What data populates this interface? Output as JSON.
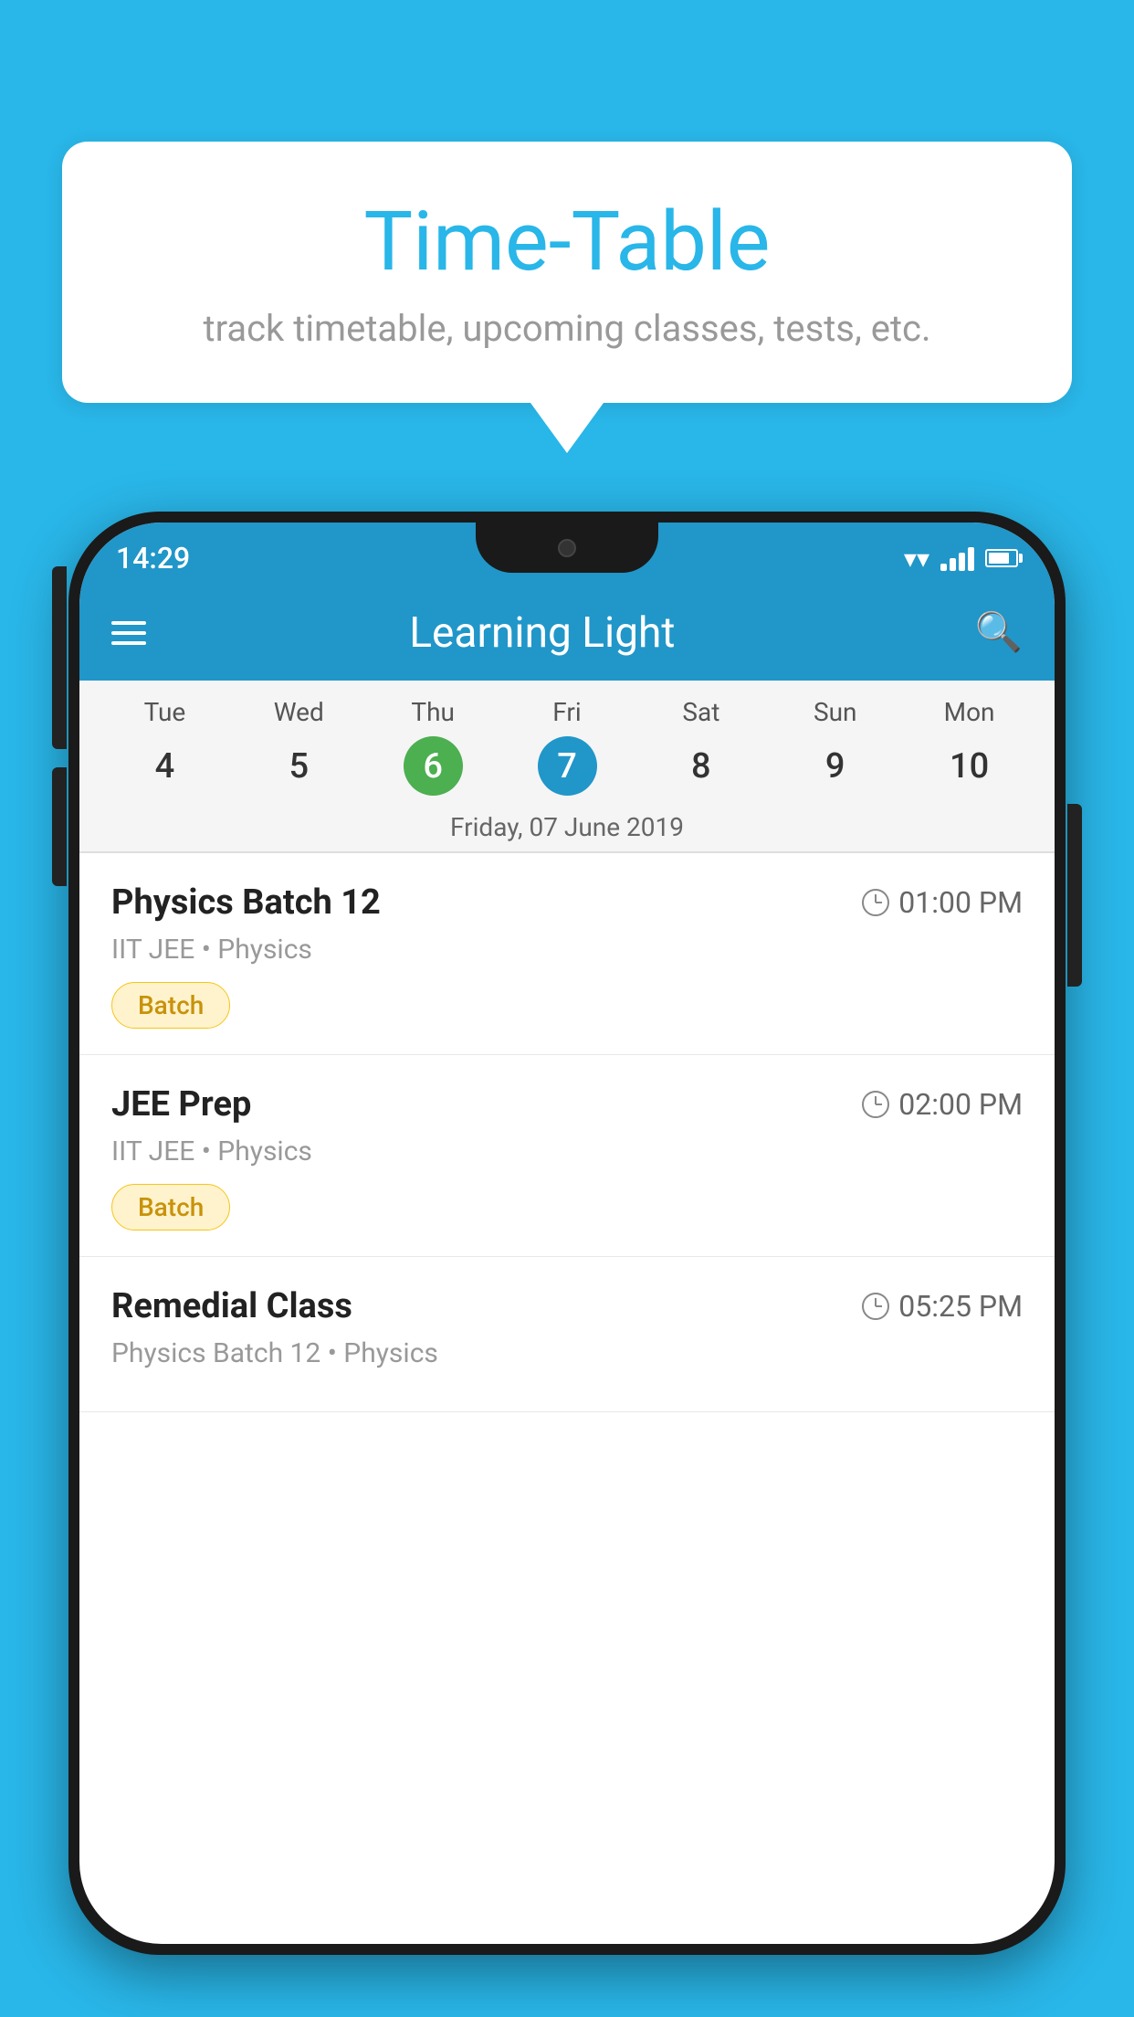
{
  "background_color": "#29b6e8",
  "speech_bubble": {
    "title": "Time-Table",
    "subtitle": "track timetable, upcoming classes, tests, etc."
  },
  "phone": {
    "status_bar": {
      "time": "14:29"
    },
    "app_bar": {
      "title": "Learning Light"
    },
    "calendar": {
      "days": [
        {
          "name": "Tue",
          "num": "4",
          "state": "normal"
        },
        {
          "name": "Wed",
          "num": "5",
          "state": "normal"
        },
        {
          "name": "Thu",
          "num": "6",
          "state": "today"
        },
        {
          "name": "Fri",
          "num": "7",
          "state": "selected"
        },
        {
          "name": "Sat",
          "num": "8",
          "state": "normal"
        },
        {
          "name": "Sun",
          "num": "9",
          "state": "normal"
        },
        {
          "name": "Mon",
          "num": "10",
          "state": "normal"
        }
      ],
      "selected_date_label": "Friday, 07 June 2019"
    },
    "schedule": [
      {
        "title": "Physics Batch 12",
        "time": "01:00 PM",
        "subtitle": "IIT JEE • Physics",
        "badge": "Batch"
      },
      {
        "title": "JEE Prep",
        "time": "02:00 PM",
        "subtitle": "IIT JEE • Physics",
        "badge": "Batch"
      },
      {
        "title": "Remedial Class",
        "time": "05:25 PM",
        "subtitle": "Physics Batch 12 • Physics",
        "badge": null
      }
    ]
  }
}
